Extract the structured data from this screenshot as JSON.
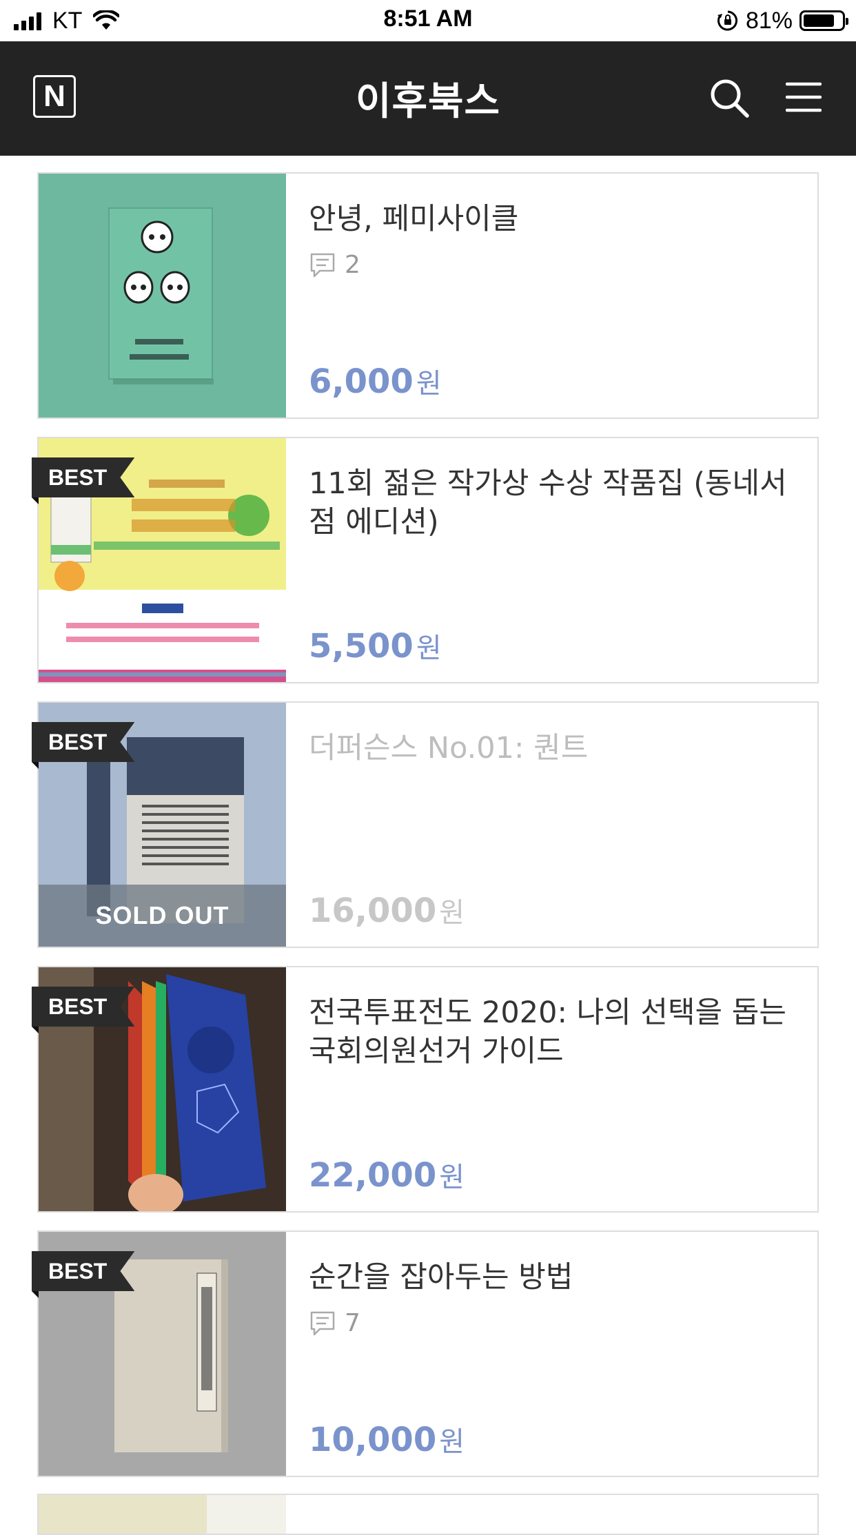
{
  "status": {
    "carrier": "KT",
    "time": "8:51 AM",
    "battery": "81%",
    "battery_level": 0.81
  },
  "header": {
    "logo": "N",
    "title": "이후북스"
  },
  "books": [
    {
      "title": "안녕, 페미사이클",
      "comments": "2",
      "price": "6,000",
      "currency": "원",
      "badge": "",
      "sold_out": false
    },
    {
      "title": "11회 젊은 작가상 수상 작품집 (동네서점 에디션)",
      "comments": "",
      "price": "5,500",
      "currency": "원",
      "badge": "BEST",
      "sold_out": false
    },
    {
      "title": "더퍼슨스 No.01: 퀀트",
      "comments": "",
      "price": "16,000",
      "currency": "원",
      "badge": "BEST",
      "sold_out": true,
      "sold_out_label": "SOLD OUT"
    },
    {
      "title": "전국투표전도 2020: 나의 선택을 돕는 국회의원선거 가이드",
      "comments": "",
      "price": "22,000",
      "currency": "원",
      "badge": "BEST",
      "sold_out": false
    },
    {
      "title": "순간을 잡아두는 방법",
      "comments": "7",
      "price": "10,000",
      "currency": "원",
      "badge": "BEST",
      "sold_out": false
    }
  ],
  "colors": {
    "header_bg": "#232323",
    "price": "#7a93cc",
    "border": "#dddddd"
  }
}
